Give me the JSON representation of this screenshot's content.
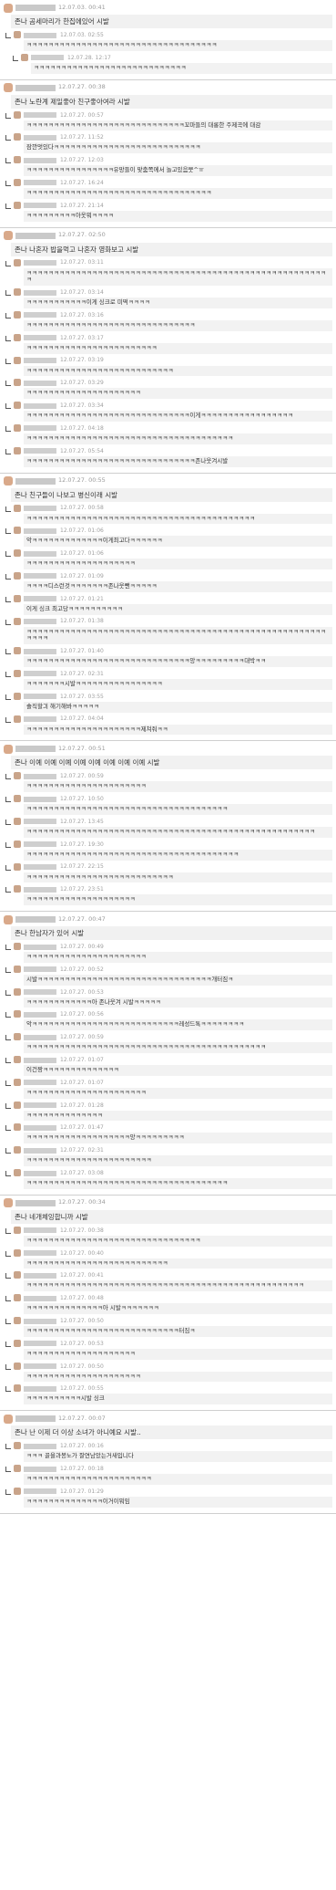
{
  "posts": [
    {
      "date": "12.07.03. 00:41",
      "title": "존나 곰세마리가 한집에있어 시발",
      "replies": [
        {
          "date": "12.07.03. 02:55",
          "text": "ㅋㅋㅋㅋㅋㅋㅋㅋㅋㅋㅋㅋㅋㅋㅋㅋㅋㅋㅋㅋㅋㅋㅋㅋㅋㅋㅋㅋㅋㅋㅋㅋㅋㅋㅋ"
        },
        {
          "date": "12.07.28. 12:17",
          "text": "ㅋㅋㅋㅋㅋㅋㅋㅋㅋㅋㅋㅋㅋㅋㅋㅋㅋㅋㅋㅋㅋㅋㅋㅋㅋㅋㅋㅋ"
        }
      ]
    },
    {
      "date": "12.07.27. 00:38",
      "title": "존나 노란계 제일좋아 친구좋아여라 시발",
      "replies": [
        {
          "date": "12.07.27. 00:57",
          "text": "ㅋㅋㅋㅋㅋㅋㅋㅋㅋㅋㅋㅋㅋㅋㅋㅋㅋㅋㅋㅋㅋㅋㅋㅋㅋㅋㅋㅋㅋ꼬마들의 대롱한 주제곡에 대감"
        },
        {
          "date": "12.07.27. 11:52",
          "text": "잠깐멋있다ㅋㅋㅋㅋㅋㅋㅋㅋㅋㅋㅋㅋㅋㅋㅋㅋㅋㅋㅋㅋㅋㅋㅋㅋㅋㅋㅋ"
        },
        {
          "date": "12.07.27. 12:03",
          "text": "ㅋㅋㅋㅋㅋㅋㅋㅋㅋㅋㅋㅋㅋㅋㅋㅋ유망들이 맞춤쪽에서 놀고있음뭇^ㅠ"
        },
        {
          "date": "12.07.27. 16:24",
          "text": "ㅋㅋㅋㅋㅋㅋㅋㅋㅋㅋㅋㅋㅋㅋㅋㅋㅋㅋㅋㅋㅋㅋㅋㅋㅋㅋㅋㅋㅋㅋㅋㅋㅋㅋ"
        },
        {
          "date": "12.07.27. 21:14",
          "text": "ㅋㅋㅋㅋㅋㅋㅋㅋㅋ아옷뭐ㅋㅋㅋㅋ"
        }
      ]
    },
    {
      "date": "12.07.27. 02:50",
      "title": "존나 나혼자 밥을먹고 나혼자 영화보고 시발",
      "replies": [
        {
          "date": "12.07.27. 03:11",
          "text": "ㅋㅋㅋㅋㅋㅋㅋㅋㅋㅋㅋㅋㅋㅋㅋㅋㅋㅋㅋㅋㅋㅋㅋㅋㅋㅋㅋㅋㅋㅋㅋㅋㅋㅋㅋㅋㅋㅋㅋㅋㅋㅋㅋㅋㅋㅋㅋㅋㅋㅋㅋㅋㅋㅋㅋㅋ"
        },
        {
          "date": "12.07.27. 03:14",
          "text": "ㅋㅋㅋㅋㅋㅋㅋㅋㅋㅋㅋ이게 싱크로 미떡ㅋㅋㅋㅋ"
        },
        {
          "date": "12.07.27. 03:16",
          "text": "ㅋㅋㅋㅋㅋㅋㅋㅋㅋㅋㅋㅋㅋㅋㅋㅋㅋㅋㅋㅋㅋㅋㅋㅋㅋㅋㅋㅋㅋㅋㅋ"
        },
        {
          "date": "12.07.27. 03:17",
          "text": "ㅋㅋㅋㅋㅋㅋㅋㅋㅋㅋㅋㅋㅋㅋㅋㅋㅋㅋㅋㅋㅋㅋㅋㅋ"
        },
        {
          "date": "12.07.27. 03:19",
          "text": "ㅋㅋㅋㅋㅋㅋㅋㅋㅋㅋㅋㅋㅋㅋㅋㅋㅋㅋㅋㅋㅋㅋㅋㅋㅋㅋㅋ"
        },
        {
          "date": "12.07.27. 03:29",
          "text": "ㅋㅋㅋㅋㅋㅋㅋㅋㅋㅋㅋㅋㅋㅋㅋㅋㅋㅋㅋㅋㅋ"
        },
        {
          "date": "12.07.27. 03:34",
          "text": "ㅋㅋㅋㅋㅋㅋㅋㅋㅋㅋㅋㅋㅋㅋㅋㅋㅋㅋㅋㅋㅋㅋㅋㅋㅋㅋㅋㅋㅋㅋ이게ㅋㅋㅋㅋㅋㅋㅋㅋㅋㅋㅋㅋㅋㅋㅋㅋㅋ"
        },
        {
          "date": "12.07.27. 04:18",
          "text": "ㅋㅋㅋㅋㅋㅋㅋㅋㅋㅋㅋㅋㅋㅋㅋㅋㅋㅋㅋㅋㅋㅋㅋㅋㅋㅋㅋㅋㅋㅋㅋㅋㅋㅋㅋㅋㅋㅋ"
        },
        {
          "date": "12.07.27. 05:54",
          "text": "ㅋㅋㅋㅋㅋㅋㅋㅋㅋㅋㅋㅋㅋㅋㅋㅋㅋㅋㅋㅋㅋㅋㅋㅋㅋㅋㅋㅋㅋㅋㅋ존나웃겨시발"
        }
      ]
    },
    {
      "date": "12.07.27. 00:55",
      "title": "존나 친구들이 나보고 병신이래 시발",
      "replies": [
        {
          "date": "12.07.27. 00:58",
          "text": "ㅋㅋㅋㅋㅋㅋㅋㅋㅋㅋㅋㅋㅋㅋㅋㅋㅋㅋㅋㅋㅋㅋㅋㅋㅋㅋㅋㅋㅋㅋㅋㅋㅋㅋㅋㅋㅋㅋㅋㅋㅋㅋ"
        },
        {
          "date": "12.07.27. 01:06",
          "text": "악ㅋㅋㅋㅋㅋㅋㅋㅋㅋㅋㅋㅋㅋ이게최고다ㅋㅋㅋㅋㅋㅋ"
        },
        {
          "date": "12.07.27. 01:06",
          "text": "ㅋㅋㅋㅋㅋㅋㅋㅋㅋㅋㅋㅋㅋㅋㅋㅋㅋㅋㅋㅋ"
        },
        {
          "date": "12.07.27. 01:09",
          "text": "ㅋㅋㅋㅋ디스런것ㅋㅋㅋㅋㅋㅋㅋ존나웃뺀ㅋㅋㅋㅋㅋ"
        },
        {
          "date": "12.07.27. 01:21",
          "text": "이게 싱크 최고당ㅋㅋㅋㅋㅋㅋㅋㅋㅋㅋ"
        },
        {
          "date": "12.07.27. 01:38",
          "text": "ㅋㅋㅋㅋㅋㅋㅋㅋㅋㅋㅋㅋㅋㅋㅋㅋㅋㅋㅋㅋㅋㅋㅋㅋㅋㅋㅋㅋㅋㅋㅋㅋㅋㅋㅋㅋㅋㅋㅋㅋㅋㅋㅋㅋㅋㅋㅋㅋㅋㅋㅋㅋㅋㅋㅋㅋㅋㅋㅋ"
        },
        {
          "date": "12.07.27. 01:40",
          "text": "ㅋㅋㅋㅋㅋㅋㅋㅋㅋㅋㅋㅋㅋㅋㅋㅋㅋㅋㅋㅋㅋㅋㅋㅋㅋㅋㅋㅋㅋㅋ앙ㅋㅋㅋㅋㅋㅋㅋㅋㅋ대박ㅋㅋ"
        },
        {
          "date": "12.07.27. 02:31",
          "text": "ㅋㅋㅋㅋㅋㅋㅋ시발ㅋㅋㅋㅋㅋㅋㅋㅋㅋㅋㅋㅋㅋㅋㅋㅋ"
        },
        {
          "date": "12.07.27. 03:55",
          "text": "솔직할긔 해기해봐ㅋㅋㅋㅋㅋ"
        },
        {
          "date": "12.07.27. 04:04",
          "text": "ㅋㅋㅋㅋㅋㅋㅋㅋㅋㅋㅋㅋㅋㅋㅋㅋㅋㅋㅋㅋㅋ제쳐줘ㅋㅋ"
        }
      ]
    },
    {
      "date": "12.07.27. 00:51",
      "title": "존나 이예 이예 이예 이예 이예 이예 이예 이예 시발",
      "replies": [
        {
          "date": "12.07.27. 00:59",
          "text": "ㅋㅋㅋㅋㅋㅋㅋㅋㅋㅋㅋㅋㅋㅋㅋㅋㅋㅋㅋㅋㅋㅋ"
        },
        {
          "date": "12.07.27. 10:50",
          "text": "ㅋㅋㅋㅋㅋㅋㅋㅋㅋㅋㅋㅋㅋㅋㅋㅋㅋㅋㅋㅋㅋㅋㅋㅋㅋㅋㅋㅋㅋㅋㅋㅋㅋㅋㅋㅋㅋ"
        },
        {
          "date": "12.07.27. 13:45",
          "text": "ㅋㅋㅋㅋㅋㅋㅋㅋㅋㅋㅋㅋㅋㅋㅋㅋㅋㅋㅋㅋㅋㅋㅋㅋㅋㅋㅋㅋㅋㅋㅋㅋㅋㅋㅋㅋㅋㅋㅋㅋㅋㅋㅋㅋㅋㅋㅋㅋㅋㅋㅋㅋㅋ"
        },
        {
          "date": "12.07.27. 19:30",
          "text": "ㅋㅋㅋㅋㅋㅋㅋㅋㅋㅋㅋㅋㅋㅋㅋㅋㅋㅋㅋㅋㅋㅋㅋㅋㅋㅋㅋㅋㅋㅋㅋㅋㅋㅋㅋㅋㅋㅋㅋ"
        },
        {
          "date": "12.07.27. 22:15",
          "text": "ㅋㅋㅋㅋㅋㅋㅋㅋㅋㅋㅋㅋㅋㅋㅋㅋㅋㅋㅋㅋㅋㅋㅋㅋㅋㅋㅋ"
        },
        {
          "date": "12.07.27. 23:51",
          "text": "ㅋㅋㅋㅋㅋㅋㅋㅋㅋㅋㅋㅋㅋㅋㅋㅋㅋㅋㅋㅋ"
        }
      ]
    },
    {
      "date": "12.07.27. 00:47",
      "title": "존나 한남자가 있어 시발",
      "replies": [
        {
          "date": "12.07.27. 00:49",
          "text": "ㅋㅋㅋㅋㅋㅋㅋㅋㅋㅋㅋㅋㅋㅋㅋㅋㅋㅋㅋㅋㅋㅋ"
        },
        {
          "date": "12.07.27. 00:52",
          "text": "시발ㅋㅋㅋㅋㅋㅋㅋㅋㅋㅋㅋㅋㅋㅋㅋㅋㅋㅋㅋㅋㅋㅋㅋㅋㅋㅋㅋㅋㅋㅋㅋㅋ개터짐ㅋ"
        },
        {
          "date": "12.07.27. 00:53",
          "text": "ㅋㅋㅋㅋㅋㅋㅋㅋㅋㅋㅋㅋ아 존나웃겨 시발ㅋㅋㅋㅋㅋ"
        },
        {
          "date": "12.07.27. 00:56",
          "text": "악ㅋㅋㅋㅋㅋㅋㅋㅋㅋㅋㅋㅋㅋㅋㅋㅋㅋㅋㅋㅋㅋㅋㅋㅋㅋㅋㅋ레성드톡ㅋㅋㅋㅋㅋㅋㅋㅋ"
        },
        {
          "date": "12.07.27. 00:59",
          "text": "ㅋㅋㅋㅋㅋㅋㅋㅋㅋㅋㅋㅋㅋㅋㅋㅋㅋㅋㅋㅋㅋㅋㅋㅋㅋㅋㅋㅋㅋㅋㅋㅋㅋㅋㅋㅋㅋㅋㅋㅋㅋㅋㅋㅋ"
        },
        {
          "date": "12.07.27. 01:07",
          "text": "이건짱ㅋㅋㅋㅋㅋㅋㅋㅋㅋㅋㅋㅋㅋㅋ"
        },
        {
          "date": "12.07.27. 01:07",
          "text": "ㅋㅋㅋㅋㅋㅋㅋㅋㅋㅋㅋㅋㅋㅋㅋㅋㅋㅋㅋㅋㅋㅋ"
        },
        {
          "date": "12.07.27. 01:28",
          "text": "ㅋㅋㅋㅋㅋㅋㅋㅋㅋㅋㅋㅋㅋㅋ"
        },
        {
          "date": "12.07.27. 01:47",
          "text": "ㅋㅋㅋㅋㅋㅋㅋㅋㅋㅋㅋㅋㅋㅋㅋㅋㅋㅋㅋ앙ㅋㅋㅋㅋㅋㅋㅋㅋㅋ"
        },
        {
          "date": "12.07.27. 02:31",
          "text": "ㅋㅋㅋㅋㅋㅋㅋㅋㅋㅋㅋㅋㅋㅋㅋㅋㅋㅋㅋㅋㅋㅋㅋ"
        },
        {
          "date": "12.07.27. 03:08",
          "text": "ㅋㅋㅋㅋㅋㅋㅋㅋㅋㅋㅋㅋㅋㅋㅋㅋㅋㅋㅋㅋㅋㅋㅋㅋㅋㅋㅋㅋㅋㅋㅋㅋㅋㅋㅋㅋㅋ"
        }
      ]
    },
    {
      "date": "12.07.27. 00:34",
      "title": "존나 네개체잉합니까 시발",
      "replies": [
        {
          "date": "12.07.27. 00:38",
          "text": "ㅋㅋㅋㅋㅋㅋㅋㅋㅋㅋㅋㅋㅋㅋㅋㅋㅋㅋㅋㅋㅋㅋㅋㅋㅋㅋㅋㅋㅋㅋㅋㅋ"
        },
        {
          "date": "12.07.27. 00:40",
          "text": "ㅋㅋㅋㅋㅋㅋㅋㅋㅋㅋㅋㅋㅋㅋㅋㅋㅋㅋㅋㅋㅋㅋㅋㅋㅋㅋ"
        },
        {
          "date": "12.07.27. 00:41",
          "text": "ㅋㅋㅋㅋㅋㅋㅋㅋㅋㅋㅋㅋㅋㅋㅋㅋㅋㅋㅋㅋㅋㅋㅋㅋㅋㅋㅋㅋㅋㅋㅋㅋㅋㅋㅋㅋㅋㅋㅋㅋㅋㅋㅋㅋㅋㅋㅋㅋㅋㅋㅋ"
        },
        {
          "date": "12.07.27. 00:48",
          "text": "ㅋㅋㅋㅋㅋㅋㅋㅋㅋㅋㅋㅋㅋㅋ아 시발ㅋㅋㅋㅋㅋㅋㅋ"
        },
        {
          "date": "12.07.27. 00:50",
          "text": "ㅋㅋㅋㅋㅋㅋㅋㅋㅋㅋㅋㅋㅋㅋㅋㅋㅋㅋㅋㅋㅋㅋㅋㅋㅋㅋㅋㅋ터짐ㅋ"
        },
        {
          "date": "12.07.27. 00:53",
          "text": "ㅋㅋㅋㅋㅋㅋㅋㅋㅋㅋㅋㅋㅋㅋㅋㅋㅋㅋㅋㅋ"
        },
        {
          "date": "12.07.27. 00:50",
          "text": "ㅋㅋㅋㅋㅋㅋㅋㅋㅋㅋㅋㅋㅋㅋㅋㅋㅋㅋㅋㅋㅋ"
        },
        {
          "date": "12.07.27. 00:55",
          "text": "ㅋㅋㅋㅋㅋㅋㅋㅋㅋㅋ시발 싱크"
        }
      ]
    },
    {
      "date": "12.07.27. 00:07",
      "title": "존나 난 이제 더 이상 소녀가 아니예요 시발..",
      "replies": [
        {
          "date": "12.07.27. 00:16",
          "text": "ㅋㅋㅋ 골을과봉노가 잘연남았는거새입니다"
        },
        {
          "date": "12.07.27. 00:18",
          "text": "ㅋㅋㅋㅋㅋㅋㅋㅋㅋㅋㅋㅋㅋㅋㅋㅋㅋㅋㅋㅋㅋㅋㅋ"
        },
        {
          "date": "12.07.27. 01:29",
          "text": "ㅋㅋㅋㅋㅋㅋㅋㅋㅋㅋㅋㅋㅋㅋ이거이뭐임"
        }
      ]
    }
  ]
}
